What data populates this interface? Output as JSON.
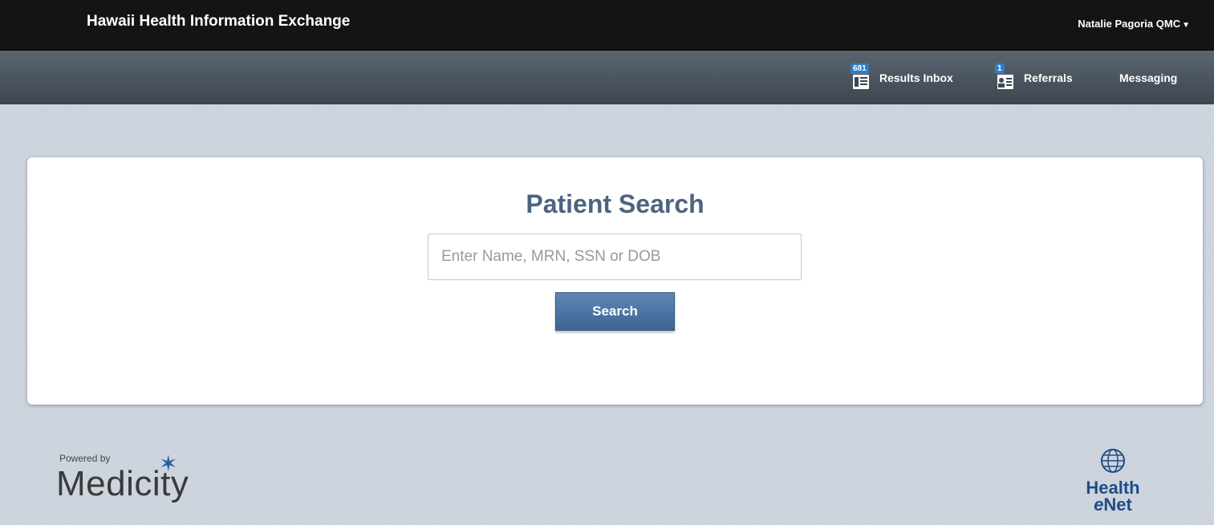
{
  "header": {
    "title": "Hawaii Health Information Exchange",
    "user_menu": "Natalie Pagoria QMC",
    "user_menu_caret": "▼"
  },
  "nav": {
    "results_inbox": {
      "label": "Results Inbox",
      "badge": "681",
      "icon": "document-list-icon"
    },
    "referrals": {
      "label": "Referrals",
      "badge": "1",
      "icon": "person-card-icon"
    },
    "messaging": {
      "label": "Messaging"
    }
  },
  "search": {
    "title": "Patient Search",
    "placeholder": "Enter Name, MRN, SSN or DOB",
    "value": "",
    "button_label": "Search"
  },
  "footer": {
    "powered_by": "Powered by",
    "medicity": "Medicity",
    "healthenet_line1": "Health",
    "healthenet_e": "e",
    "healthenet_line2": "Net"
  },
  "colors": {
    "topbar": "#141414",
    "navbar": "#4a535d",
    "title_blue": "#4b6480",
    "button_blue": "#4a73a3",
    "badge_blue": "#2f7ec9"
  }
}
